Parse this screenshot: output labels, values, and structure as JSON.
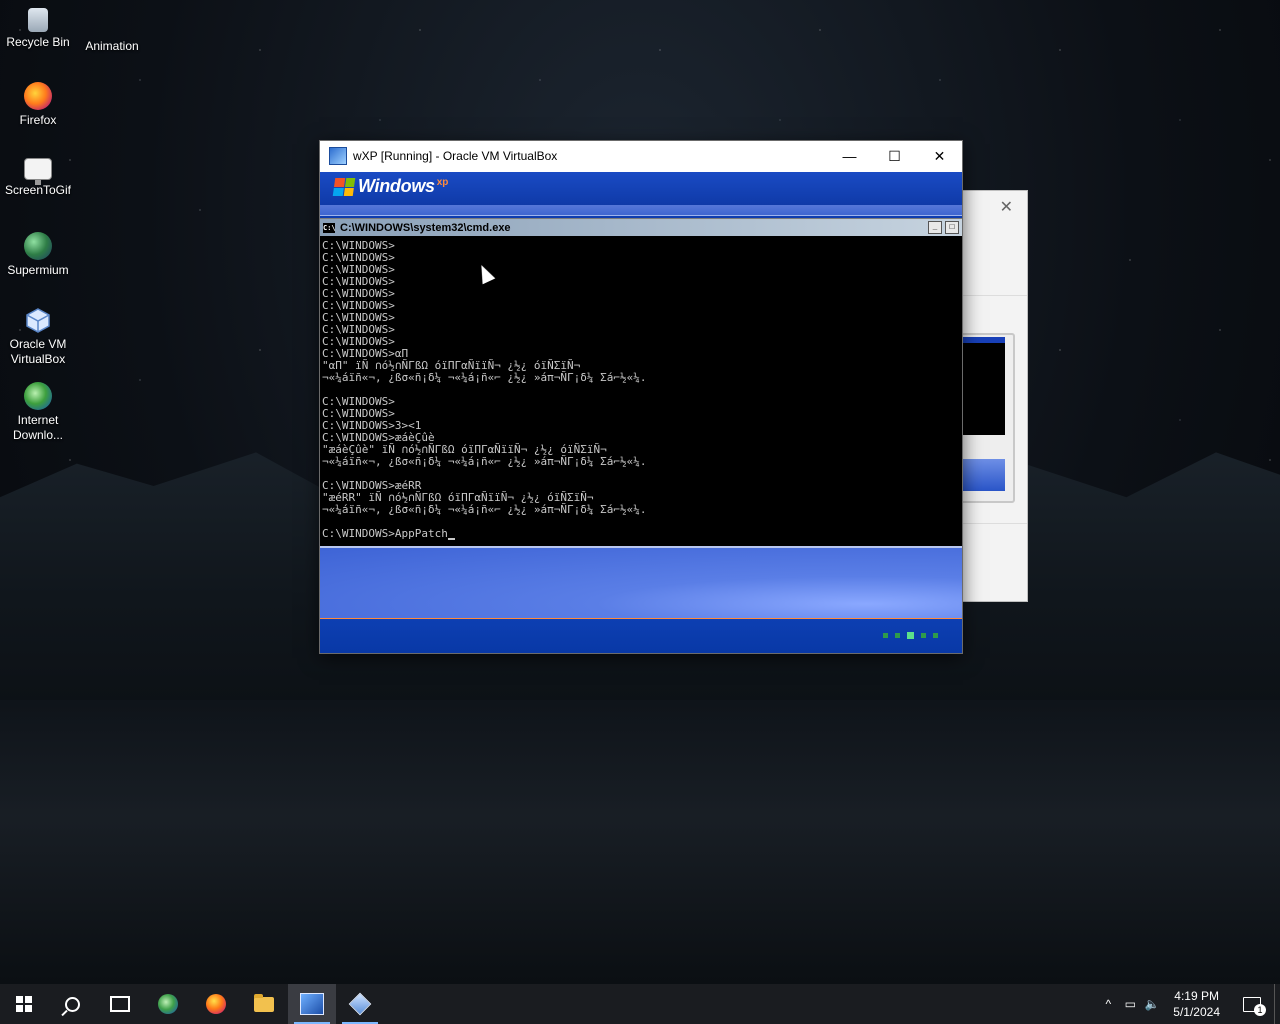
{
  "desktop": {
    "icons": [
      {
        "label": "Recycle Bin",
        "icon": "recycle-bin-icon"
      },
      {
        "label": "Animation",
        "icon": "animation-icon"
      },
      {
        "label": "Firefox",
        "icon": "firefox-icon"
      },
      {
        "label": "ScreenToGif",
        "icon": "screentogif-icon"
      },
      {
        "label": "Supermium",
        "icon": "supermium-icon"
      },
      {
        "label": "Oracle VM VirtualBox",
        "icon": "virtualbox-icon"
      },
      {
        "label": "Internet Downlo...",
        "icon": "internet-download-icon"
      }
    ]
  },
  "vbox_window": {
    "title": "wXP [Running] - Oracle VM VirtualBox",
    "controls": {
      "minimize": "—",
      "maximize": "☐",
      "close": "✕"
    }
  },
  "guest": {
    "xp_logo_text": "Windows",
    "xp_logo_sup": "xp",
    "cmd": {
      "title": "C:\\WINDOWS\\system32\\cmd.exe",
      "icon_text": "C:\\",
      "lines": [
        "C:\\WINDOWS>",
        "C:\\WINDOWS>",
        "C:\\WINDOWS>",
        "C:\\WINDOWS>",
        "C:\\WINDOWS>",
        "C:\\WINDOWS>",
        "C:\\WINDOWS>",
        "C:\\WINDOWS>",
        "C:\\WINDOWS>",
        "C:\\WINDOWS>αΠ",
        "\"αΠ\" ïÑ ∩ó½∩ÑΓßΩ óïΠΓαÑïïÑ¬ ¿½¿ óïÑΣïÑ¬",
        "¬«¼áïñ«¬, ¿ßσ«ñ¡δ¼ ¬«¼á¡ñ«⌐ ¿½¿ »áπ¬ÑΓ¡δ¼ Σá⌐½«¼.",
        "",
        "C:\\WINDOWS>",
        "C:\\WINDOWS>",
        "C:\\WINDOWS>3><1",
        "C:\\WINDOWS>æáèÇûè",
        "\"æáèÇûè\" ïÑ ∩ó½∩ÑΓßΩ óïΠΓαÑïïÑ¬ ¿½¿ óïÑΣïÑ¬",
        "¬«¼áïñ«¬, ¿ßσ«ñ¡δ¼ ¬«¼á¡ñ«⌐ ¿½¿ »áπ¬ÑΓ¡δ¼ Σá⌐½«¼.",
        "",
        "C:\\WINDOWS>æéRR",
        "\"æéRR\" ïÑ ∩ó½∩ÑΓßΩ óïΠΓαÑïïÑ¬ ¿½¿ óïÑΣïÑ¬",
        "¬«¼áïñ«¬, ¿ßσ«ñ¡δ¼ ¬«¼á¡ñ«⌐ ¿½¿ »áπ¬ÑΓ¡δ¼ Σá⌐½«¼.",
        "",
        "C:\\WINDOWS>AppPatch"
      ]
    }
  },
  "taskbar": {
    "apps": [
      {
        "icon": "start-windows-icon"
      },
      {
        "icon": "search-icon"
      },
      {
        "icon": "task-view-icon"
      },
      {
        "icon": "edge-browser-icon"
      },
      {
        "icon": "firefox-icon"
      },
      {
        "icon": "file-explorer-icon"
      },
      {
        "icon": "virtualbox-xp-vm-icon"
      },
      {
        "icon": "virtualbox-manager-icon"
      }
    ],
    "tray": {
      "chevron": "^",
      "time": "4:19 PM",
      "date": "5/1/2024",
      "notification_count": "1"
    }
  }
}
